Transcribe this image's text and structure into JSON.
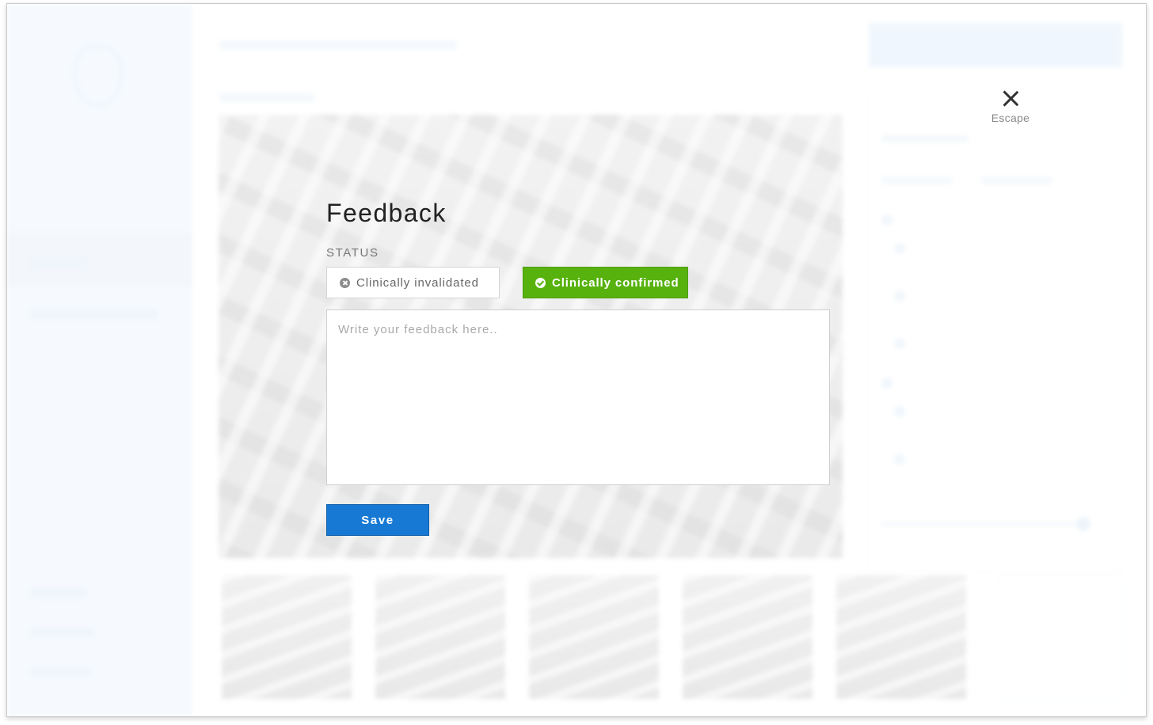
{
  "modal": {
    "close_label": "Escape",
    "title": "Feedback",
    "status_label": "STATUS",
    "status_options": [
      {
        "label": "Clinically invalidated",
        "selected": false
      },
      {
        "label": "Clinically confirmed",
        "selected": true
      }
    ],
    "feedback_placeholder": "Write your feedback here..",
    "feedback_value": "",
    "save_label": "Save"
  },
  "colors": {
    "confirm": "#58b20e",
    "primary": "#1779d4",
    "sidebar_bg": "#e6f1fb"
  }
}
